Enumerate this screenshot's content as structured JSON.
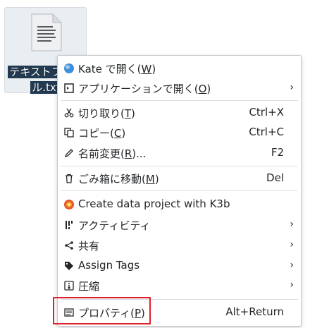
{
  "file": {
    "label_line1": "テキストファイ",
    "label_line2": "ル.txt",
    "icon": "text-document-icon"
  },
  "menu": {
    "items": [
      {
        "name": "open-with-kate",
        "label": "Kate で開く(",
        "mnemonic": "W",
        "label_end": ")",
        "icon": "kate-icon"
      },
      {
        "name": "open-with-application",
        "label": "アプリケーションで開く(",
        "mnemonic": "O",
        "label_end": ")",
        "icon": "application-icon",
        "submenu": true
      },
      {
        "name": "cut",
        "label": "切り取り(",
        "mnemonic": "T",
        "label_end": ")",
        "shortcut": "Ctrl+X",
        "icon": "scissors-icon"
      },
      {
        "name": "copy",
        "label": "コピー(",
        "mnemonic": "C",
        "label_end": ")",
        "shortcut": "Ctrl+C",
        "icon": "copy-icon"
      },
      {
        "name": "rename",
        "label": "名前変更(",
        "mnemonic": "R",
        "label_end": ")...",
        "shortcut": "F2",
        "icon": "pencil-icon"
      },
      {
        "name": "move-to-trash",
        "label": "ごみ箱に移動(",
        "mnemonic": "M",
        "label_end": ")",
        "shortcut": "Del",
        "icon": "trash-icon"
      },
      {
        "name": "create-data-project-k3b",
        "label": "Create data project with K3b",
        "icon": "k3b-icon"
      },
      {
        "name": "activities",
        "label": "アクティビティ",
        "icon": "activities-icon",
        "submenu": true
      },
      {
        "name": "share",
        "label": "共有",
        "icon": "share-icon",
        "submenu": true
      },
      {
        "name": "assign-tags",
        "label": "Assign Tags",
        "icon": "tag-icon",
        "submenu": true
      },
      {
        "name": "compress",
        "label": "圧縮",
        "icon": "compress-icon",
        "submenu": true
      },
      {
        "name": "properties",
        "label": "プロパティ(",
        "mnemonic": "P",
        "label_end": ")",
        "shortcut": "Alt+Return",
        "icon": "properties-icon"
      }
    ],
    "submenu_glyph": "›"
  },
  "colors": {
    "highlight": "#e0202a",
    "selection_bg": "#233b52"
  }
}
